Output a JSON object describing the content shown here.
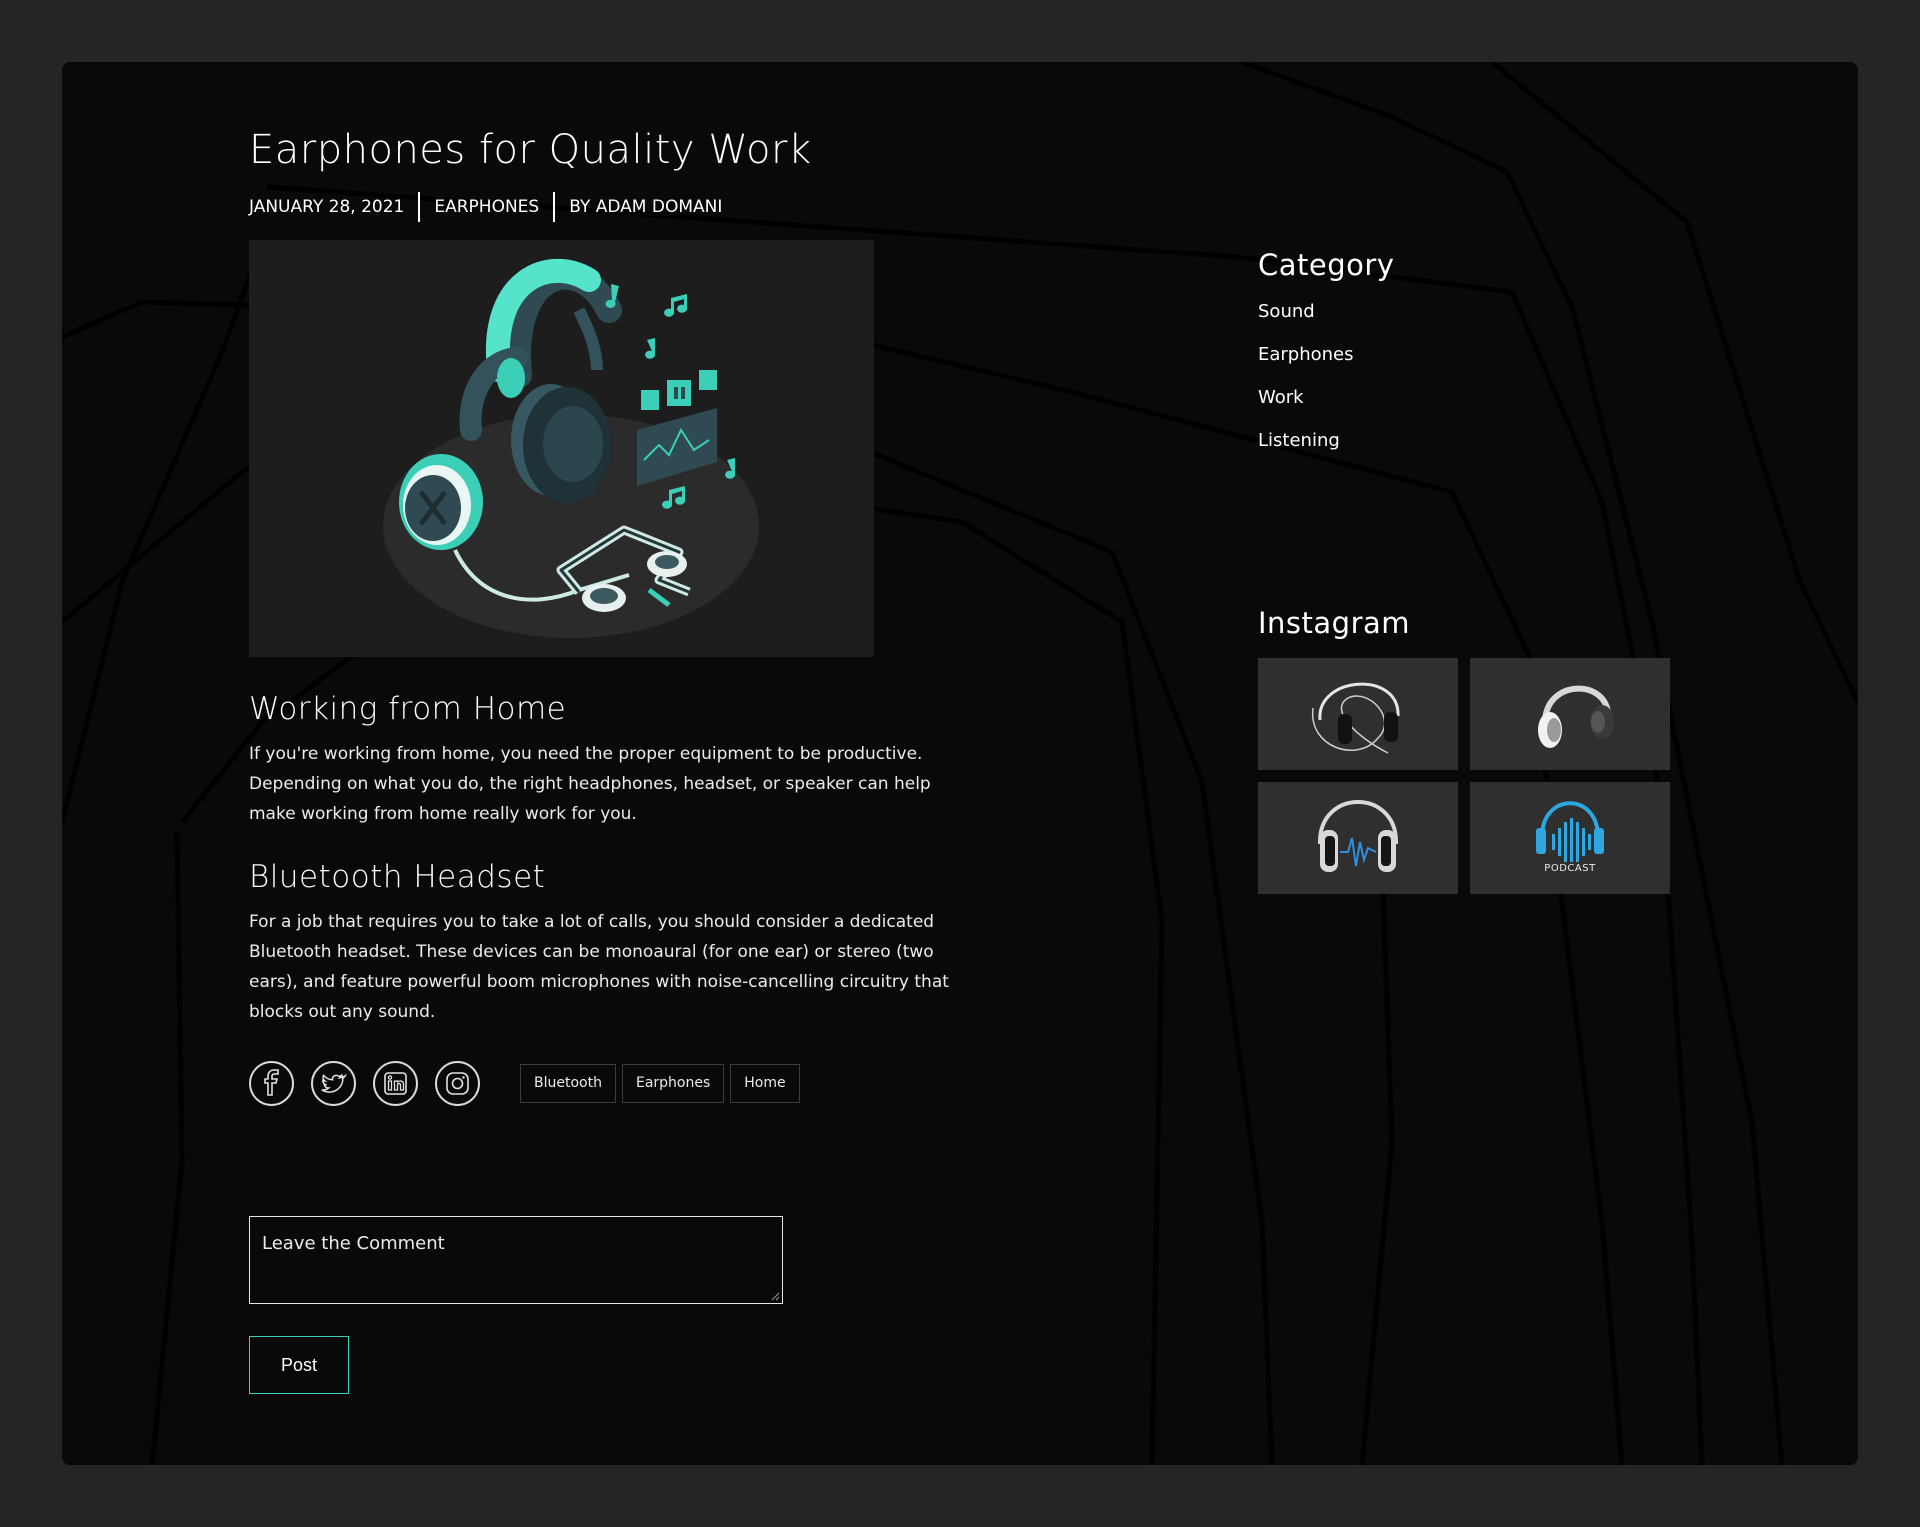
{
  "post": {
    "title": "Earphones for Quality Work",
    "meta": {
      "date": "JANUARY 28, 2021",
      "category": "EARPHONES",
      "author": "BY ADAM DOMANI"
    },
    "hero_image_icon": "headphones-illustration",
    "sections": [
      {
        "heading": "Working  from  Home",
        "body": "If you're working from home, you need the proper equipment to be productive. Depending on what you do, the right headphones, headset, or speaker can help make working from home really work for you."
      },
      {
        "heading": "Bluetooth  Headset",
        "body": "For a job that requires you to take a lot of calls, you should consider a dedicated Bluetooth headset. These devices can be monoaural (for one ear) or stereo (two ears), and feature powerful boom microphones with noise-cancelling circuitry that blocks out any sound."
      }
    ],
    "social_icons": [
      "facebook-icon",
      "twitter-icon",
      "linkedin-icon",
      "instagram-icon"
    ],
    "tags": [
      "Bluetooth",
      "Earphones",
      "Home"
    ]
  },
  "comment": {
    "placeholder": "Leave  the  Comment",
    "post_label": "Post"
  },
  "sidebar": {
    "category_heading": "Category",
    "categories": [
      "Sound",
      "Earphones",
      "Work",
      "Listening"
    ],
    "instagram_heading": "Instagram",
    "instagram_tiles": [
      {
        "icon": "headphones-icon"
      },
      {
        "icon": "headphones-icon"
      },
      {
        "icon": "headphones-icon"
      },
      {
        "icon": "podcast-headphones-icon",
        "label": "PODCAST"
      }
    ]
  },
  "colors": {
    "page_bg": "#252525",
    "card_bg": "#090909",
    "accent": "#3ccfb8",
    "text": "#ffffff"
  }
}
